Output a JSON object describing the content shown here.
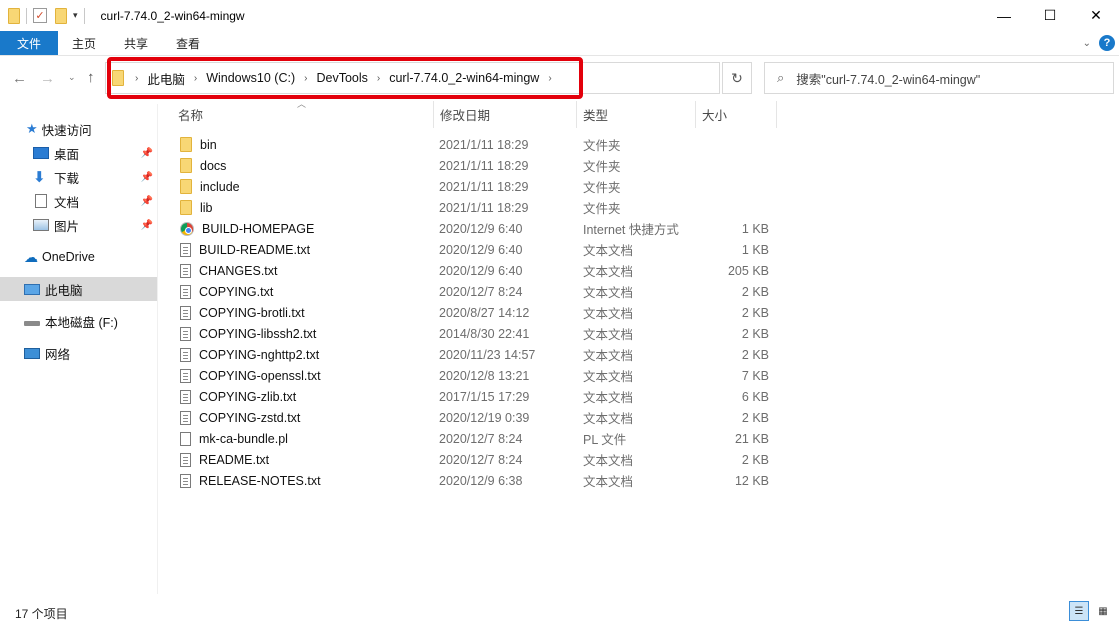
{
  "window": {
    "title": "curl-7.74.0_2-win64-mingw",
    "controls": [
      "—",
      "☐",
      "✕"
    ]
  },
  "ribbon": {
    "tabs": [
      "文件",
      "主页",
      "共享",
      "查看"
    ],
    "help": "?"
  },
  "breadcrumb": [
    "此电脑",
    "Windows10 (C:)",
    "DevTools",
    "curl-7.74.0_2-win64-mingw"
  ],
  "search": {
    "placeholder": "搜索\"curl-7.74.0_2-win64-mingw\""
  },
  "sidebar": {
    "items": [
      {
        "label": "快速访问",
        "icon": "star-icon"
      },
      {
        "label": "桌面",
        "icon": "desktop-icon",
        "pinned": true
      },
      {
        "label": "下载",
        "icon": "download-icon",
        "pinned": true
      },
      {
        "label": "文档",
        "icon": "document-icon",
        "pinned": true
      },
      {
        "label": "图片",
        "icon": "picture-icon",
        "pinned": true
      },
      {
        "label": "OneDrive",
        "icon": "cloud-icon"
      },
      {
        "label": "此电脑",
        "icon": "computer-icon",
        "selected": true
      },
      {
        "label": "本地磁盘 (F:)",
        "icon": "drive-icon"
      },
      {
        "label": "网络",
        "icon": "network-icon"
      }
    ]
  },
  "columns": [
    "名称",
    "修改日期",
    "类型",
    "大小"
  ],
  "files": [
    {
      "name": "bin",
      "date": "2021/1/11 18:29",
      "type": "文件夹",
      "size": "",
      "icon": "folder"
    },
    {
      "name": "docs",
      "date": "2021/1/11 18:29",
      "type": "文件夹",
      "size": "",
      "icon": "folder"
    },
    {
      "name": "include",
      "date": "2021/1/11 18:29",
      "type": "文件夹",
      "size": "",
      "icon": "folder"
    },
    {
      "name": "lib",
      "date": "2021/1/11 18:29",
      "type": "文件夹",
      "size": "",
      "icon": "folder"
    },
    {
      "name": "BUILD-HOMEPAGE",
      "date": "2020/12/9 6:40",
      "type": "Internet 快捷方式",
      "size": "1 KB",
      "icon": "web"
    },
    {
      "name": "BUILD-README.txt",
      "date": "2020/12/9 6:40",
      "type": "文本文档",
      "size": "1 KB",
      "icon": "txt"
    },
    {
      "name": "CHANGES.txt",
      "date": "2020/12/9 6:40",
      "type": "文本文档",
      "size": "205 KB",
      "icon": "txt"
    },
    {
      "name": "COPYING.txt",
      "date": "2020/12/7 8:24",
      "type": "文本文档",
      "size": "2 KB",
      "icon": "txt"
    },
    {
      "name": "COPYING-brotli.txt",
      "date": "2020/8/27 14:12",
      "type": "文本文档",
      "size": "2 KB",
      "icon": "txt"
    },
    {
      "name": "COPYING-libssh2.txt",
      "date": "2014/8/30 22:41",
      "type": "文本文档",
      "size": "2 KB",
      "icon": "txt"
    },
    {
      "name": "COPYING-nghttp2.txt",
      "date": "2020/11/23 14:57",
      "type": "文本文档",
      "size": "2 KB",
      "icon": "txt"
    },
    {
      "name": "COPYING-openssl.txt",
      "date": "2020/12/8 13:21",
      "type": "文本文档",
      "size": "7 KB",
      "icon": "txt"
    },
    {
      "name": "COPYING-zlib.txt",
      "date": "2017/1/15 17:29",
      "type": "文本文档",
      "size": "6 KB",
      "icon": "txt"
    },
    {
      "name": "COPYING-zstd.txt",
      "date": "2020/12/19 0:39",
      "type": "文本文档",
      "size": "2 KB",
      "icon": "txt"
    },
    {
      "name": "mk-ca-bundle.pl",
      "date": "2020/12/7 8:24",
      "type": "PL 文件",
      "size": "21 KB",
      "icon": "pl"
    },
    {
      "name": "README.txt",
      "date": "2020/12/7 8:24",
      "type": "文本文档",
      "size": "2 KB",
      "icon": "txt"
    },
    {
      "name": "RELEASE-NOTES.txt",
      "date": "2020/12/9 6:38",
      "type": "文本文档",
      "size": "12 KB",
      "icon": "txt"
    }
  ],
  "status": {
    "item_count": "17 个项目"
  },
  "colors": {
    "accent": "#1979ca",
    "highlight_box": "#e3000b",
    "folder": "#f8d775"
  }
}
